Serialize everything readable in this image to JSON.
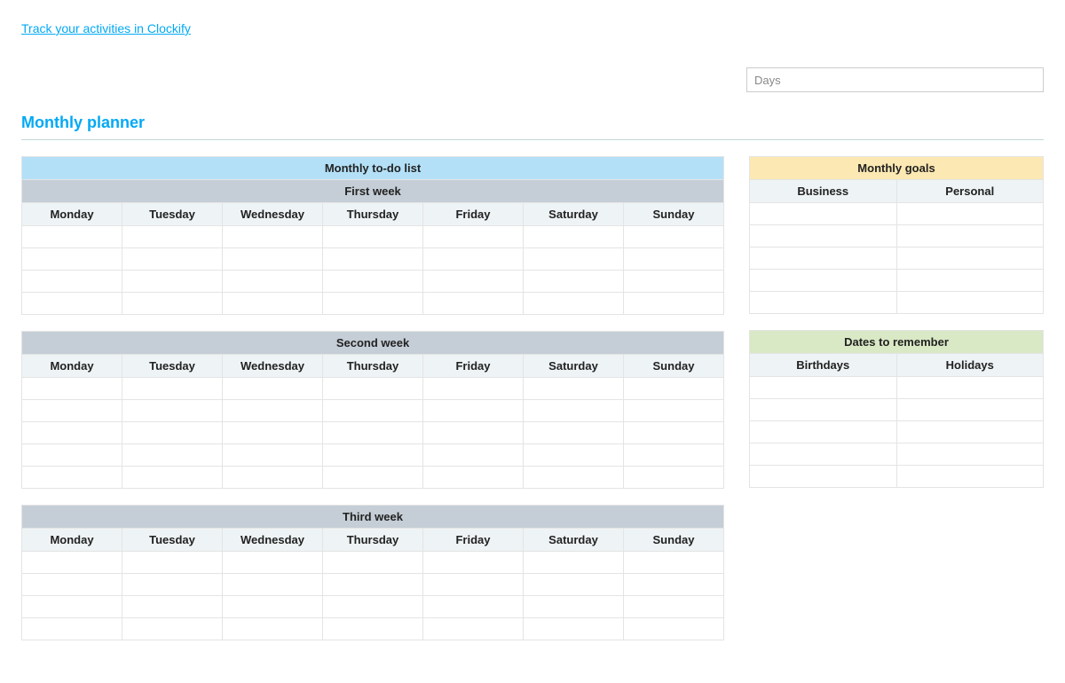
{
  "top_link": "Track your activities in Clockify",
  "days_input": {
    "placeholder": "Days",
    "value": ""
  },
  "page_title": "Monthly planner",
  "todo_header": "Monthly to-do list",
  "days": [
    "Monday",
    "Tuesday",
    "Wednesday",
    "Thursday",
    "Friday",
    "Saturday",
    "Sunday"
  ],
  "weeks": [
    {
      "label": "First week",
      "rows": 4
    },
    {
      "label": "Second week",
      "rows": 5
    },
    {
      "label": "Third week",
      "rows": 4
    }
  ],
  "goals": {
    "header": "Monthly goals",
    "columns": [
      "Business",
      "Personal"
    ],
    "rows": 5
  },
  "dates": {
    "header": "Dates to remember",
    "columns": [
      "Birthdays",
      "Holidays"
    ],
    "rows": 5
  }
}
